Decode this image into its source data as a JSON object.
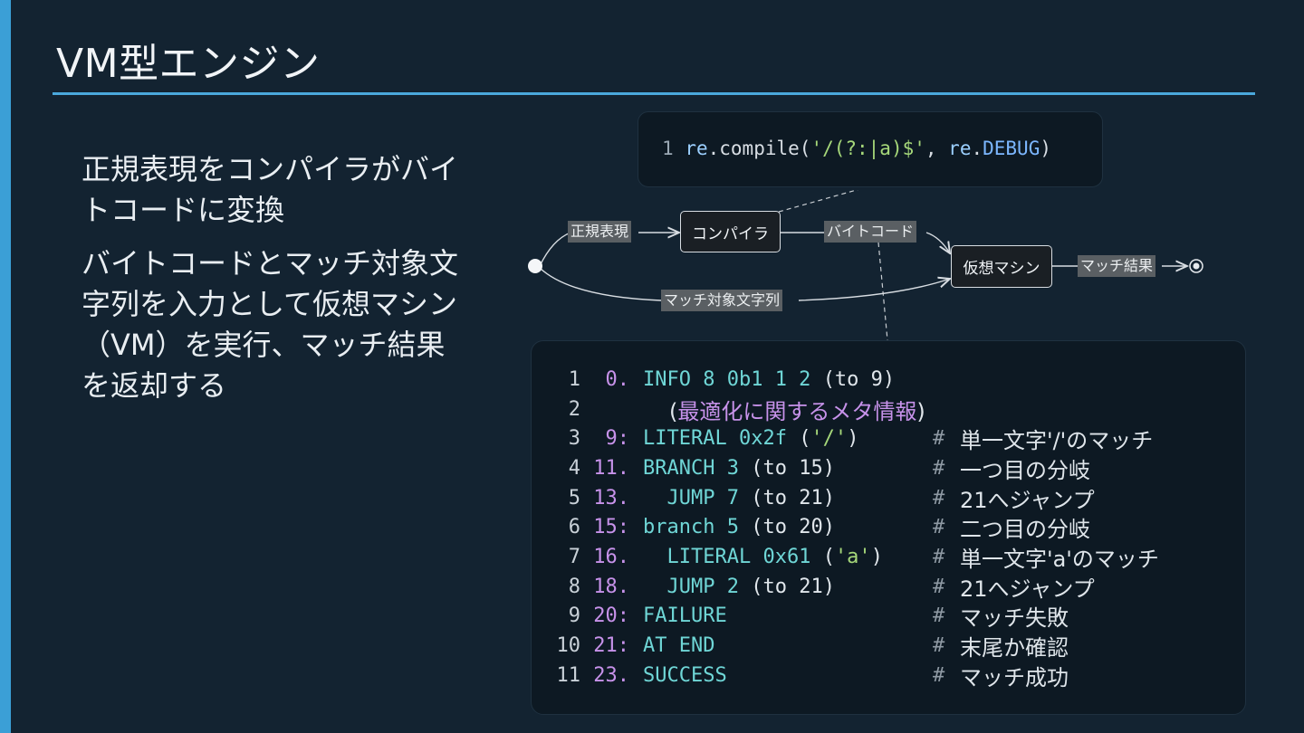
{
  "slide": {
    "title": "VM型エンジン",
    "bullets": [
      "正規表現をコンパイラがバイトコードに変換",
      "バイトコードとマッチ対象文字列を入力として仮想マシン（VM）を実行、マッチ結果を返却する"
    ]
  },
  "code_top": {
    "line_number": "1",
    "module": "re",
    "dot": ".",
    "func": "compile",
    "open": "(",
    "pattern": "'/(?:|a)$'",
    "sep": ", ",
    "flag_module": "re",
    "flag_dot": ".",
    "flag": "DEBUG",
    "close": ")"
  },
  "diagram": {
    "nodes": {
      "compiler": "コンパイラ",
      "vm": "仮想マシン"
    },
    "labels": {
      "regex": "正規表現",
      "bytecode": "バイトコード",
      "match_result": "マッチ結果",
      "target_string": "マッチ対象文字列"
    }
  },
  "code_main": {
    "lines": [
      {
        "ln": "1",
        "addr": "0.",
        "op": "INFO 8 0b1 1 2 ",
        "paren": "(to 9)",
        "str": "",
        "tail": "",
        "comment": ""
      },
      {
        "ln": "2",
        "meta_open": "(",
        "meta": "最適化に関するメタ情報",
        "meta_close": ")"
      },
      {
        "ln": "3",
        "addr": "9:",
        "op": "LITERAL 0x2f ",
        "paren": "(",
        "str": "'/'",
        "tail": ")",
        "comment": "単一文字'/'のマッチ"
      },
      {
        "ln": "4",
        "addr": "11.",
        "op": "BRANCH 3 ",
        "paren": "(to 15)",
        "str": "",
        "tail": "",
        "comment": "一つ目の分岐"
      },
      {
        "ln": "5",
        "addr": "13.",
        "op": "  JUMP 7 ",
        "paren": "(to 21)",
        "str": "",
        "tail": "",
        "comment": "21へジャンプ"
      },
      {
        "ln": "6",
        "addr": "15:",
        "op": "branch 5 ",
        "paren": "(to 20)",
        "str": "",
        "tail": "",
        "comment": "二つ目の分岐"
      },
      {
        "ln": "7",
        "addr": "16.",
        "op": "  LITERAL 0x61 ",
        "paren": "(",
        "str": "'a'",
        "tail": ")",
        "comment": "単一文字'a'のマッチ"
      },
      {
        "ln": "8",
        "addr": "18.",
        "op": "  JUMP 2 ",
        "paren": "(to 21)",
        "str": "",
        "tail": "",
        "comment": "21へジャンプ"
      },
      {
        "ln": "9",
        "addr": "20:",
        "op": "FAILURE",
        "paren": "",
        "str": "",
        "tail": "",
        "comment": "マッチ失敗"
      },
      {
        "ln": "10",
        "addr": "21:",
        "op": "AT END",
        "paren": "",
        "str": "",
        "tail": "",
        "comment": "末尾か確認"
      },
      {
        "ln": "11",
        "addr": "23.",
        "op": "SUCCESS",
        "paren": "",
        "str": "",
        "tail": "",
        "comment": "マッチ成功"
      }
    ],
    "hash": "#"
  }
}
